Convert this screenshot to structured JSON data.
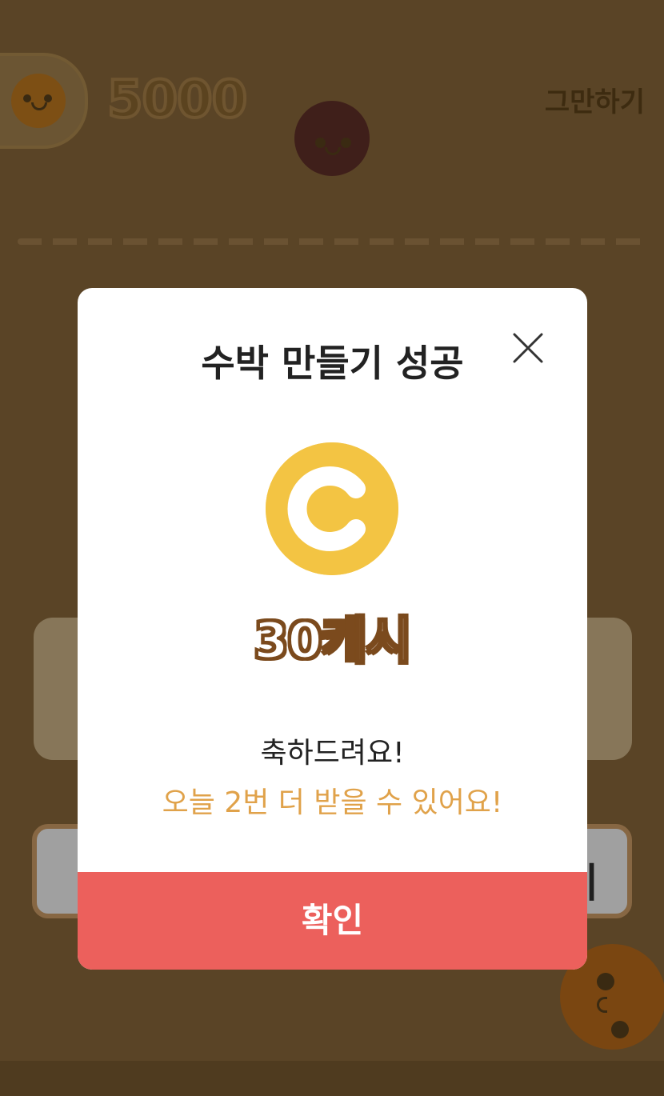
{
  "game": {
    "score": "5000",
    "quit_label": "그만하기",
    "bg_button_partial": "기"
  },
  "modal": {
    "title": "수박 만들기 성공",
    "reward_label": "30캐시",
    "message_line1": "축하드려요!",
    "message_line2": "오늘 2번 더 받을 수 있어요!",
    "confirm_label": "확인"
  },
  "colors": {
    "accent_orange": "#e0a24a",
    "confirm_red": "#ec605c",
    "coin_yellow": "#f3c443"
  },
  "icons": {
    "close": "close-icon",
    "coin": "coin-icon"
  }
}
